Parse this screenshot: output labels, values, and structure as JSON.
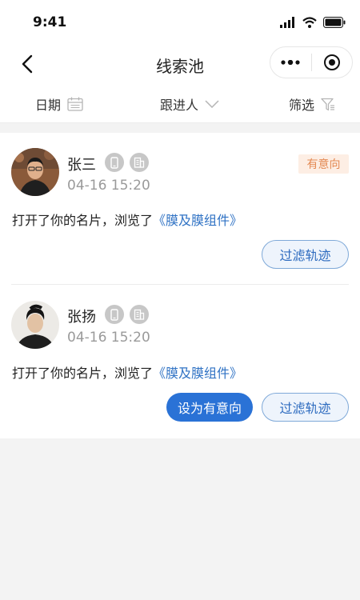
{
  "status": {
    "time": "9:41"
  },
  "nav": {
    "title": "线索池",
    "back_icon": "chevron-left-icon",
    "more_icon": "more-dots-icon",
    "target_icon": "target-icon"
  },
  "filters": [
    {
      "label": "日期",
      "icon": "calendar-icon"
    },
    {
      "label": "跟进人",
      "icon": "chevron-down-icon"
    },
    {
      "label": "筛选",
      "icon": "funnel-icon"
    }
  ],
  "leads": [
    {
      "name": "张三",
      "time": "04-16 15:20",
      "tag": "有意向",
      "desc_prefix": "打开了你的名片，浏览了",
      "desc_link": "《膜及膜组件》",
      "actions": [
        "过滤轨迹"
      ]
    },
    {
      "name": "张扬",
      "time": "04-16 15:20",
      "tag": "",
      "desc_prefix": "打开了你的名片，浏览了",
      "desc_link": "《膜及膜组件》",
      "actions": [
        "设为有意向",
        "过滤轨迹"
      ]
    }
  ],
  "colors": {
    "accent": "#2a72d6",
    "link": "#2f72c4",
    "tag_bg": "#fdeee4",
    "tag_text": "#e48a54"
  }
}
